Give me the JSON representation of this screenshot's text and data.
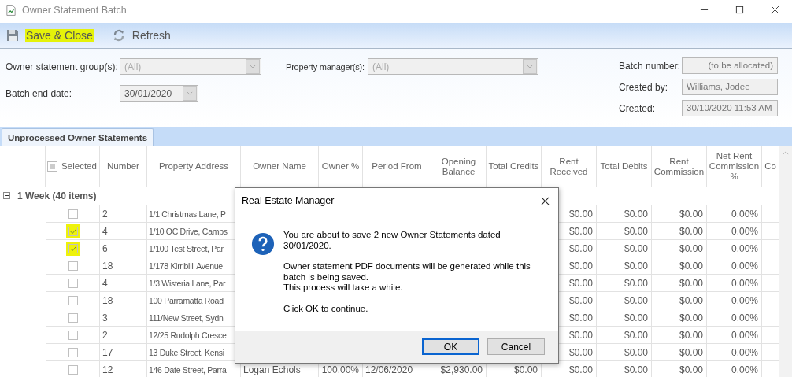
{
  "window": {
    "title": "Owner Statement Batch"
  },
  "toolbar": [
    {
      "kind": "save",
      "label": "Save & Close",
      "highlighted": true
    },
    {
      "kind": "refresh",
      "label": "Refresh",
      "highlighted": false
    }
  ],
  "filters": {
    "group": {
      "label": "Owner statement group(s):",
      "value": "(All)"
    },
    "manager": {
      "label": "Property manager(s):",
      "value": "(All)"
    },
    "end_date": {
      "label": "Batch end date:",
      "value": "30/01/2020"
    }
  },
  "batch": [
    {
      "label": "Batch number:",
      "value": "(to be allocated)"
    },
    {
      "label": "Created by:",
      "value": "Williams, Jodee"
    },
    {
      "label": "Created:",
      "value": "30/10/2020 11:53 AM"
    }
  ],
  "tabs": [
    {
      "label": "Unprocessed Owner Statements",
      "selected": true
    }
  ],
  "table": {
    "select_all_indeterminate": true,
    "columns": [
      {
        "label": "Selected"
      },
      {
        "label": "Number"
      },
      {
        "label": "Property Address"
      },
      {
        "label": "Owner Name"
      },
      {
        "label": "Owner %"
      },
      {
        "label": "Period From"
      },
      {
        "label": "Opening Balance"
      },
      {
        "label": "Total Credits"
      },
      {
        "label": "Rent Received"
      },
      {
        "label": "Total Debits"
      },
      {
        "label": "Rent Commission"
      },
      {
        "label": "Net Rent Commission %"
      },
      {
        "label": "Co"
      }
    ],
    "group": {
      "label": "1 Week (40 items)",
      "expanded": true
    },
    "rows": [
      {
        "selected": false,
        "highlighted": false,
        "number": "2",
        "address": "1/1 Christmas Lane, P",
        "rent_received": "$0.00",
        "debits": "$0.00",
        "commission": "$0.00",
        "net_pct": "0.00%"
      },
      {
        "selected": true,
        "highlighted": true,
        "number": "4",
        "address": "1/10 OC Drive, Camps",
        "rent_received": "$0.00",
        "debits": "$0.00",
        "commission": "$0.00",
        "net_pct": "0.00%"
      },
      {
        "selected": true,
        "highlighted": true,
        "number": "6",
        "address": "1/100 Test  Street, Par",
        "rent_received": "$0.00",
        "debits": "$0.00",
        "commission": "$0.00",
        "net_pct": "0.00%"
      },
      {
        "selected": false,
        "highlighted": false,
        "number": "18",
        "address": "1/178 Kirribilli Avenue",
        "rent_received": "$0.00",
        "debits": "$0.00",
        "commission": "$0.00",
        "net_pct": "0.00%"
      },
      {
        "selected": false,
        "highlighted": false,
        "number": "4",
        "address": "1/3 Wisteria Lane, Par",
        "rent_received": "$0.00",
        "debits": "$0.00",
        "commission": "$0.00",
        "net_pct": "0.00%"
      },
      {
        "selected": false,
        "highlighted": false,
        "number": "18",
        "address": "100 Parramatta Road",
        "rent_received": "$0.00",
        "debits": "$0.00",
        "commission": "$0.00",
        "net_pct": "0.00%"
      },
      {
        "selected": false,
        "highlighted": false,
        "number": "3",
        "address": "111/New Street, Sydn",
        "rent_received": "$0.00",
        "debits": "$0.00",
        "commission": "$0.00",
        "net_pct": "0.00%"
      },
      {
        "selected": false,
        "highlighted": false,
        "number": "2",
        "address": "12/25 Rudolph Cresce",
        "rent_received": "$0.00",
        "debits": "$0.00",
        "commission": "$0.00",
        "net_pct": "0.00%"
      },
      {
        "selected": false,
        "highlighted": false,
        "number": "17",
        "address": "13 Duke Street, Kensi",
        "rent_received": "$0.00",
        "debits": "$0.00",
        "commission": "$0.00",
        "net_pct": "0.00%"
      },
      {
        "selected": false,
        "highlighted": false,
        "number": "12",
        "address": "146 Date Street, Parra",
        "owner": "Logan Echols",
        "owner_pct": "100.00%",
        "period_from": "12/06/2020",
        "opening": "$2,930.00",
        "credits": "$0.00",
        "rent_received": "$0.00",
        "debits": "$0.00",
        "commission": "$0.00",
        "net_pct": "0.00%"
      }
    ]
  },
  "dialog": {
    "title": "Real Estate Manager",
    "kind": "question",
    "paragraphs": [
      [
        "You are about to save 2 new Owner Statements dated 30/01/2020."
      ],
      [
        "Owner statement PDF documents will be generated while this batch is being saved.",
        "This process will take a while."
      ],
      [
        "Click OK to continue."
      ]
    ],
    "buttons": [
      {
        "label": "OK",
        "default": true
      },
      {
        "label": "Cancel",
        "default": false
      }
    ]
  }
}
